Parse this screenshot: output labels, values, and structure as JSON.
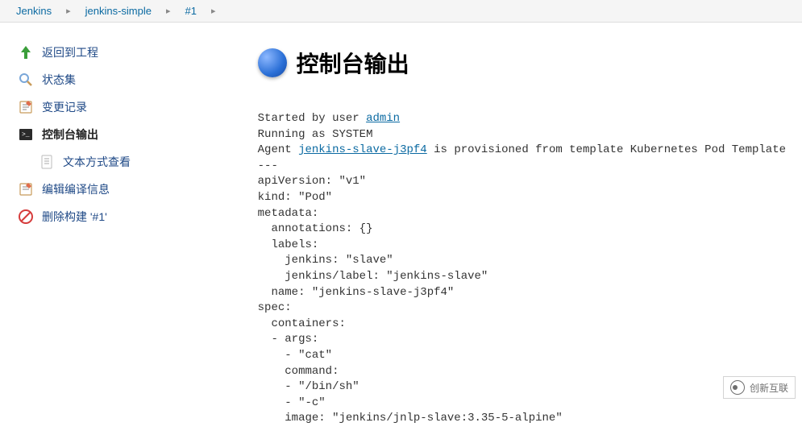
{
  "breadcrumb": {
    "items": [
      "Jenkins",
      "jenkins-simple",
      "#1"
    ]
  },
  "sidebar": {
    "items": [
      {
        "label": "返回到工程"
      },
      {
        "label": "状态集"
      },
      {
        "label": "变更记录"
      },
      {
        "label": "控制台输出"
      },
      {
        "label": "文本方式查看"
      },
      {
        "label": "编辑编译信息"
      },
      {
        "label": "删除构建 '#1'"
      }
    ]
  },
  "page": {
    "title": "控制台输出"
  },
  "console": {
    "prefix": "Started by user ",
    "user_link": "admin",
    "line2": "Running as SYSTEM",
    "line3a": "Agent ",
    "agent_link": "jenkins-slave-j3pf4",
    "line3b": " is provisioned from template Kubernetes Pod Template",
    "yaml": "---\napiVersion: \"v1\"\nkind: \"Pod\"\nmetadata:\n  annotations: {}\n  labels:\n    jenkins: \"slave\"\n    jenkins/label: \"jenkins-slave\"\n  name: \"jenkins-slave-j3pf4\"\nspec:\n  containers:\n  - args:\n    - \"cat\"\n    command:\n    - \"/bin/sh\"\n    - \"-c\"\n    image: \"jenkins/jnlp-slave:3.35-5-alpine\""
  },
  "watermark": {
    "text": "创新互联"
  }
}
